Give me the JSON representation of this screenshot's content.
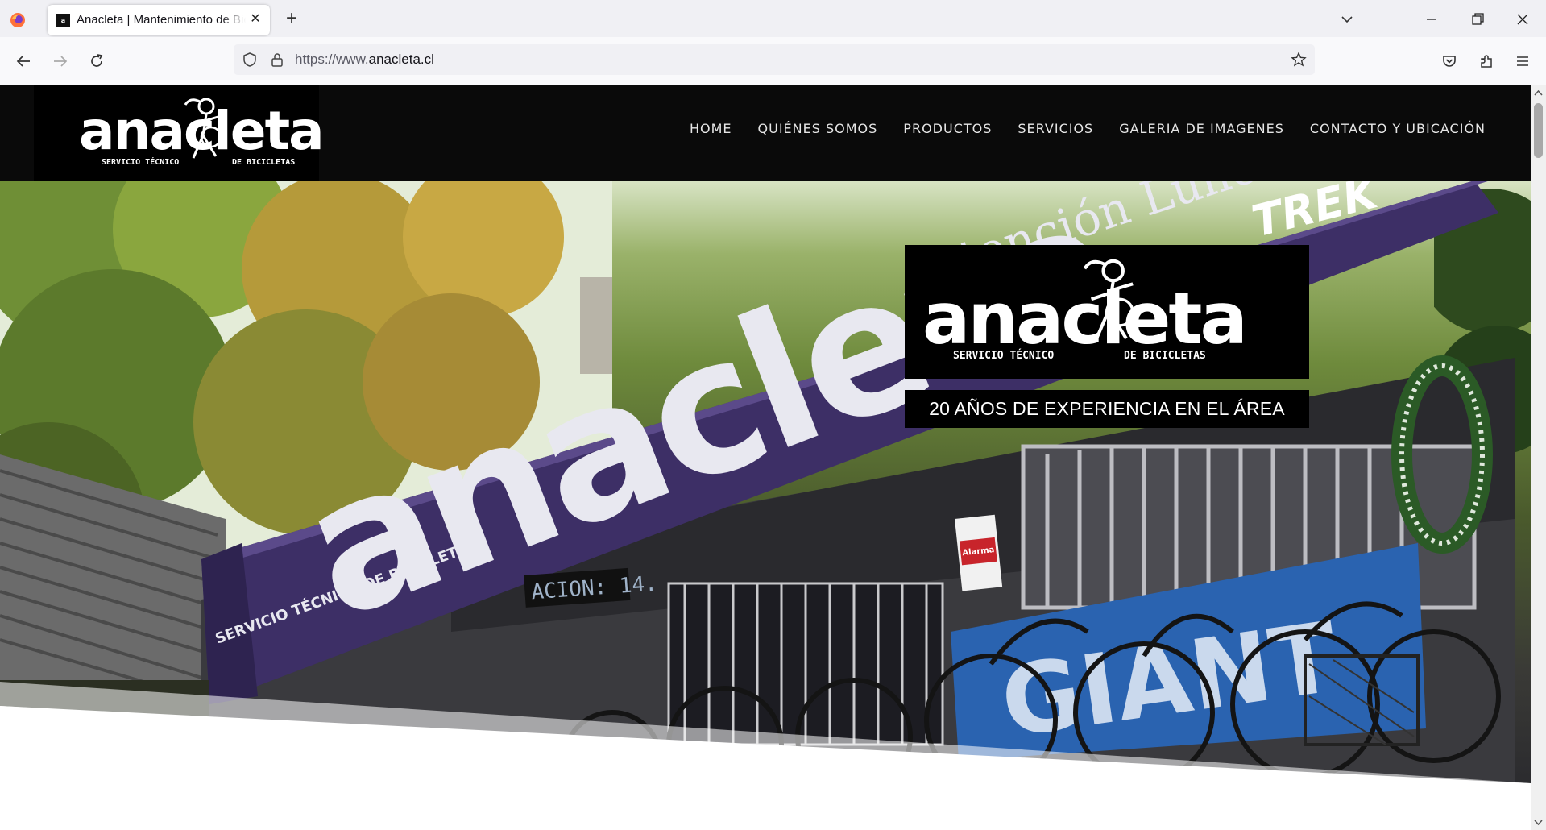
{
  "browser": {
    "tab_title": "Anacleta | Mantenimiento de Bicicletas",
    "tab_favicon_text": "a",
    "url_scheme": "https://www.",
    "url_host": "anacleta.cl",
    "colors": {
      "chrome_bg": "#f0f0f4",
      "toolbar_bg": "#f9f9fb",
      "accent_firefox": "#ff7139"
    }
  },
  "site": {
    "logo": {
      "word": "anacleta",
      "sub_left": "SERVICIO TÉCNICO",
      "sub_right": "DE BICICLETAS"
    },
    "menu": [
      {
        "label": "HOME"
      },
      {
        "label": "QUIÉNES SOMOS"
      },
      {
        "label": "PRODUCTOS"
      },
      {
        "label": "SERVICIOS"
      },
      {
        "label": "GALERIA DE IMAGENES"
      },
      {
        "label": "CONTACTO Y UBICACIÓN"
      }
    ],
    "hero": {
      "promo_logo": {
        "word": "anacleta",
        "sub_left": "SERVICIO TÉCNICO",
        "sub_right": "DE BICICLETAS"
      },
      "tagline": "20 AÑOS DE EXPERIENCIA EN EL ÁREA",
      "banner_word": "anacleta",
      "banner_side_text": "SERVICIO TÉCNICO DE BICICLETAS",
      "sign_top": "Atención Lunes",
      "brand_sign": "TREK",
      "led_sign": "ACION: 14.",
      "alarm_sign": "Alarma",
      "giant_banner": "GIANT",
      "colors": {
        "banner_purple": "#3d2f66",
        "header_black": "#0a0a0a"
      }
    }
  }
}
